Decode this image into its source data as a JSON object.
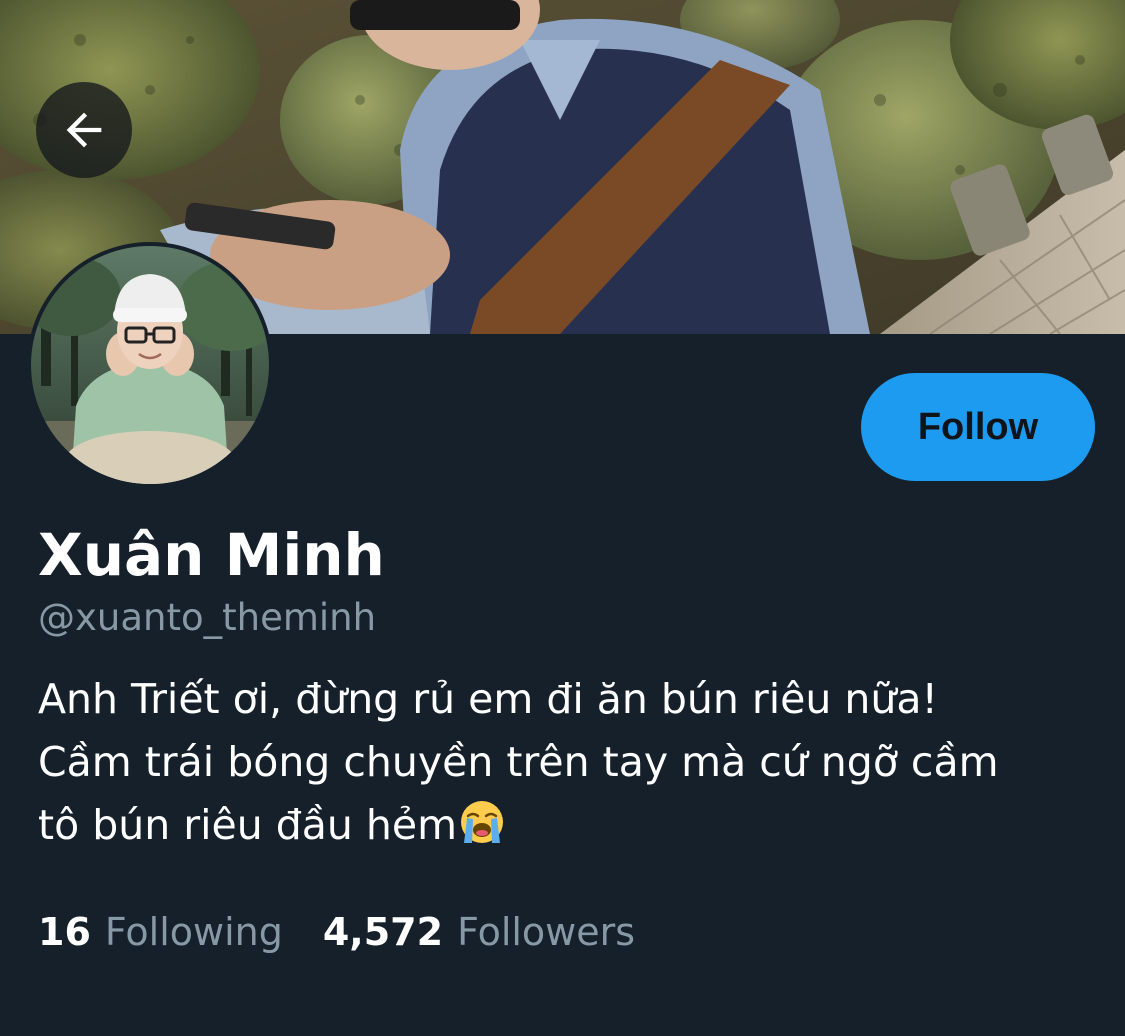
{
  "colors": {
    "background": "#15202b",
    "accent": "#1d9bf0",
    "text_primary": "#ffffff",
    "text_secondary": "#8899a6"
  },
  "header": {
    "back_icon": "arrow-left-icon",
    "banner_image": "banner-photo"
  },
  "profile": {
    "avatar_image": "avatar-photo",
    "display_name": "Xuân Minh",
    "handle": "@xuanto_theminh",
    "bio_lines": [
      "Anh Triết ơi, đừng rủ em đi ăn bún riêu nữa!",
      "Cầm trái bóng chuyền trên tay mà cứ ngỡ cầm",
      "tô bún riêu đầu hẻm"
    ],
    "bio_emoji": "loudly-crying-face-icon"
  },
  "actions": {
    "follow_label": "Follow"
  },
  "stats": {
    "following_count": "16",
    "following_label": "Following",
    "followers_count": "4,572",
    "followers_label": "Followers"
  }
}
